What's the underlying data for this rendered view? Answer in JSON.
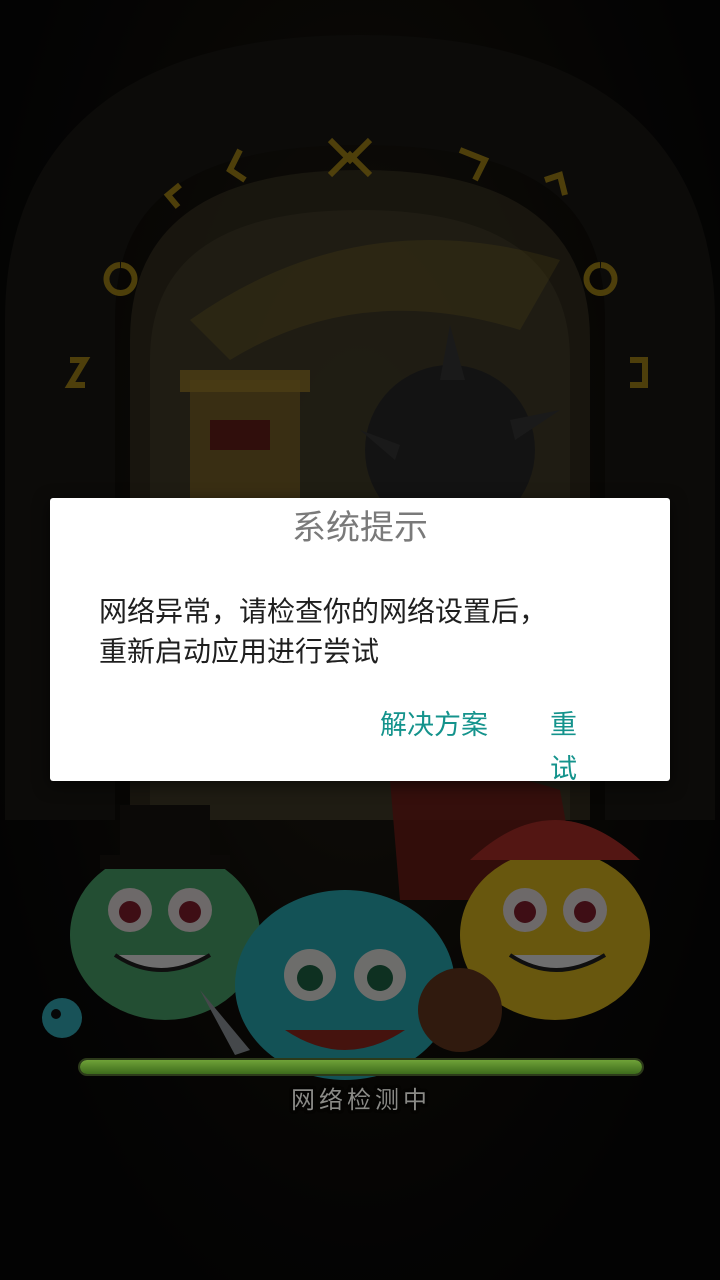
{
  "dialog": {
    "title": "系统提示",
    "message_line1": "网络异常，请检查你的网络设置后，",
    "message_line2": "重新启动应用进行尝试",
    "buttons": {
      "solution_label": "解决方案",
      "retry_label": "重试"
    },
    "accent_color": "#14938c"
  },
  "loading": {
    "status_text": "网络检测中",
    "progress": 1.0
  },
  "background": {
    "description_icons": [
      "castle-gate-icon",
      "spiked-ball-icon",
      "tower-icon",
      "green-slime-icon",
      "teal-slime-icon",
      "yellow-slime-icon",
      "red-dragon-icon"
    ]
  }
}
